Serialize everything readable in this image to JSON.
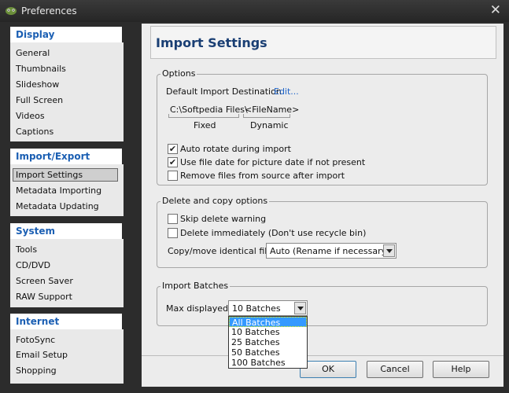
{
  "window": {
    "title": "Preferences",
    "close_glyph": "✕"
  },
  "sidebar": {
    "sections": [
      {
        "title": "Display",
        "items": [
          "General",
          "Thumbnails",
          "Slideshow",
          "Full Screen",
          "Videos",
          "Captions"
        ]
      },
      {
        "title": "Import/Export",
        "items": [
          "Import Settings",
          "Metadata Importing",
          "Metadata Updating"
        ],
        "selected": "Import Settings"
      },
      {
        "title": "System",
        "items": [
          "Tools",
          "CD/DVD",
          "Screen Saver",
          "RAW Support"
        ]
      },
      {
        "title": "Internet",
        "items": [
          "FotoSync",
          "Email Setup",
          "Shopping"
        ]
      }
    ]
  },
  "main": {
    "title": "Import Settings",
    "options": {
      "legend": "Options",
      "dest_label": "Default Import Destination",
      "edit_link": "Edit...",
      "fixed_path": "C:\\Softpedia Files\\",
      "dynamic_path": "<FileName>",
      "fixed_caption": "Fixed",
      "dynamic_caption": "Dynamic",
      "checks": [
        {
          "label": "Auto rotate during import",
          "checked": true
        },
        {
          "label": "Use file date for picture date if not present",
          "checked": true
        },
        {
          "label": "Remove files from source after import",
          "checked": false
        }
      ]
    },
    "delete_copy": {
      "legend": "Delete and copy options",
      "checks": [
        {
          "label": "Skip delete warning",
          "checked": false
        },
        {
          "label": "Delete immediately (Don't use recycle bin)",
          "checked": false
        }
      ],
      "identical_label": "Copy/move identical files",
      "identical_value": "Auto (Rename if necessary)"
    },
    "batches": {
      "legend": "Import Batches",
      "max_label": "Max displayed",
      "max_value": "10 Batches",
      "options": [
        "All Batches",
        "10 Batches",
        "25 Batches",
        "50 Batches",
        "100 Batches"
      ],
      "highlighted": "All Batches"
    },
    "buttons": {
      "ok": "OK",
      "cancel": "Cancel",
      "help": "Help"
    }
  },
  "colors": {
    "accent": "#1b5fb3",
    "title": "#1a3f74",
    "link": "#1d63c8",
    "highlight": "#3399ff"
  },
  "icons": [
    "app-icon",
    "close-icon",
    "check-icon",
    "chevron-down-icon"
  ]
}
